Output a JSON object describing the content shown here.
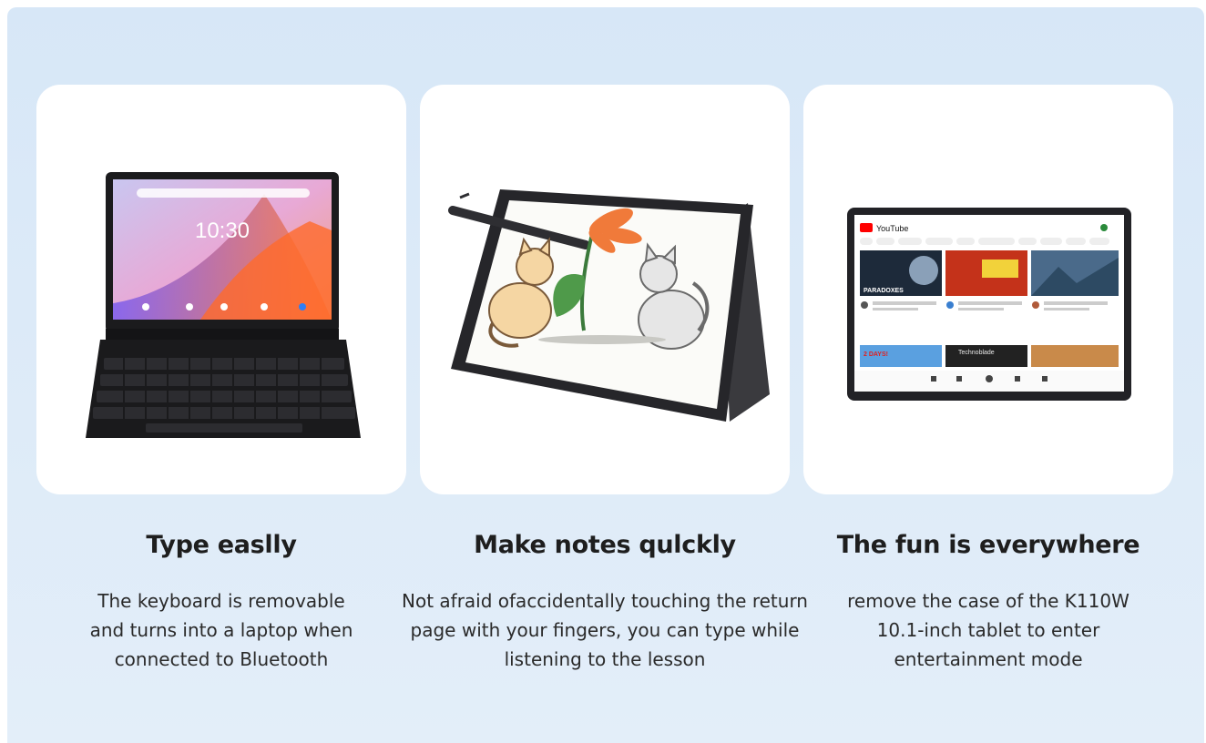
{
  "features": [
    {
      "title": "Type easlly",
      "description_lines": [
        "The keyboard is removable",
        "and turns into a laptop when",
        "connected to Bluetooth"
      ],
      "screen_clock": "10:30"
    },
    {
      "title": "Make notes qulckly",
      "description_lines": [
        "Not afraid ofaccidentally touching the return",
        "page with your fingers, you can type while",
        "listening to the lesson"
      ]
    },
    {
      "title": "The fun is everywhere",
      "description_lines": [
        "remove the case of the K110W",
        "10.1-inch tablet to enter",
        "entertainment mode"
      ],
      "screen_app": "YouTube",
      "thumbnail_captions": [
        "PARADOXES",
        "2 DAYS!",
        "Technoblade"
      ]
    }
  ],
  "colors": {
    "background_top": "#d7e7f7",
    "card": "#ffffff",
    "title_text": "#1e1e1e",
    "body_text": "#2a2a2a",
    "youtube_red": "#ff0000"
  }
}
